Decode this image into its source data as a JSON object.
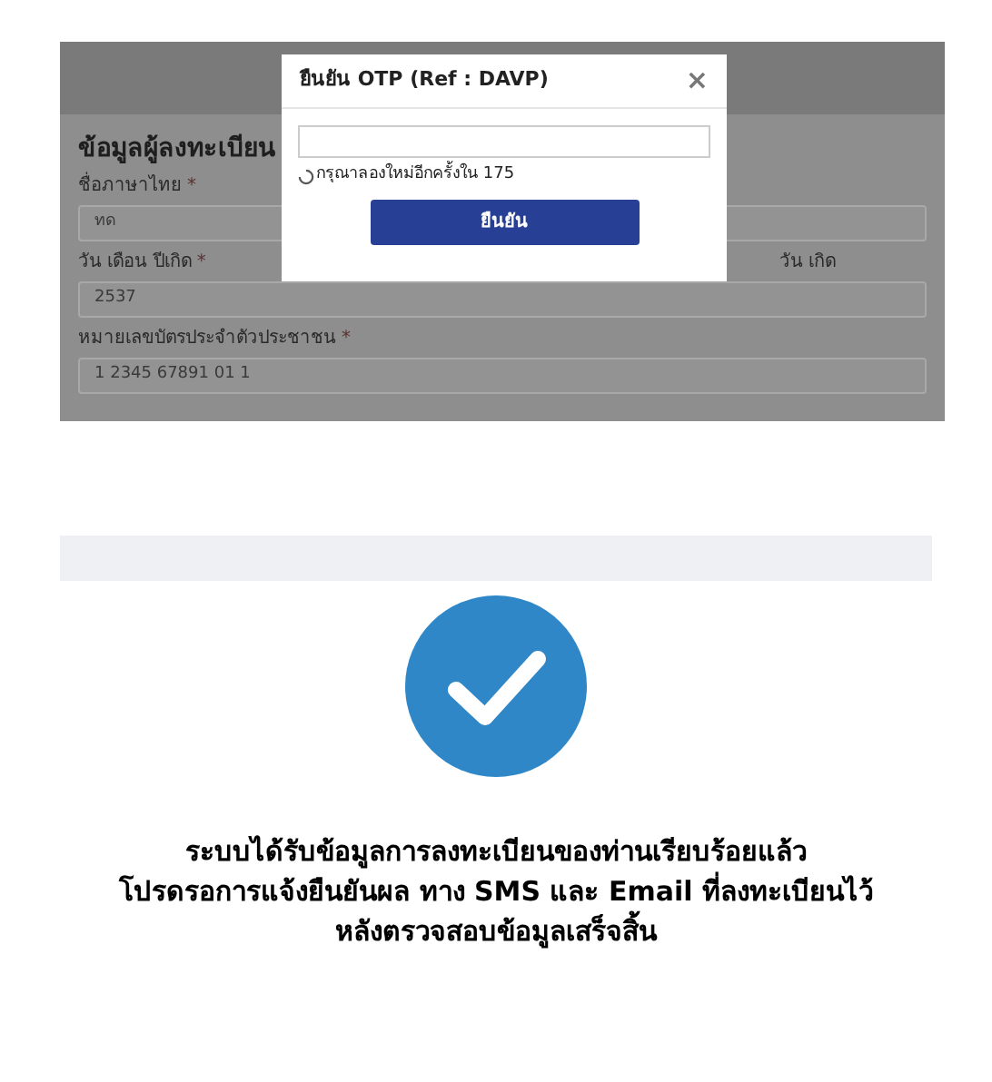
{
  "form": {
    "heading": "ข้อมูลผู้ลงทะเบียน",
    "fields": [
      {
        "label": "ชื่อภาษาไทย",
        "required_mark": "*",
        "value": "ทด"
      },
      {
        "label": "วัน เดือน ปีเกิด",
        "required_mark": "*",
        "value": "2537",
        "side_label": "วัน เกิด"
      },
      {
        "label": "หมายเลขบัตรประจำตัวประชาชน",
        "required_mark": "*",
        "value": "1 2345 67891 01 1"
      }
    ]
  },
  "modal": {
    "title": "ยืนยัน OTP (Ref : DAVP)",
    "close": "×",
    "retry_text": "กรุณาลองใหม่อีกครั้งใน 175",
    "button": "ยืนยัน"
  },
  "success": {
    "lines": [
      "ระบบได้รับข้อมูลการลงทะเบียนของท่านเรียบร้อยแล้ว",
      "โปรดรอการแจ้งยืนยันผล ทาง SMS และ Email ที่ลงทะเบียนไว้",
      "หลังตรวจสอบข้อมูลเสร็จสิ้น"
    ]
  }
}
